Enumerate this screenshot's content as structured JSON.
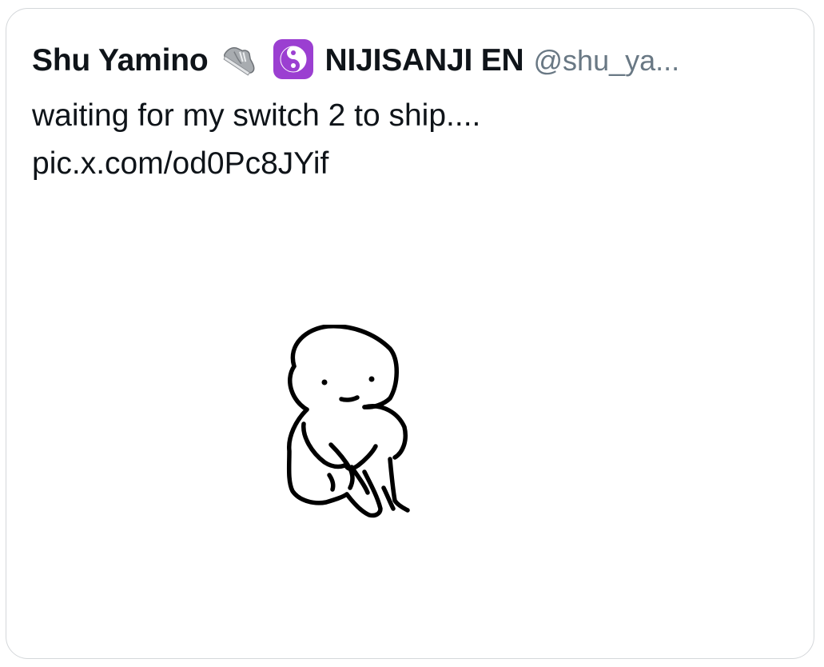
{
  "tweet": {
    "display_name": "Shu Yamino",
    "badges": [
      {
        "icon": "sneaker-icon"
      },
      {
        "icon": "yin-yang-icon",
        "color": "#9b3fd1"
      }
    ],
    "affiliation": "NIJISANJI EN",
    "handle": "@shu_ya...",
    "text_line_1": "waiting for my switch 2 to ship....",
    "text_line_2": "pic.x.com/od0Pc8JYif",
    "media_icon": "sitting-doodle-figure"
  }
}
